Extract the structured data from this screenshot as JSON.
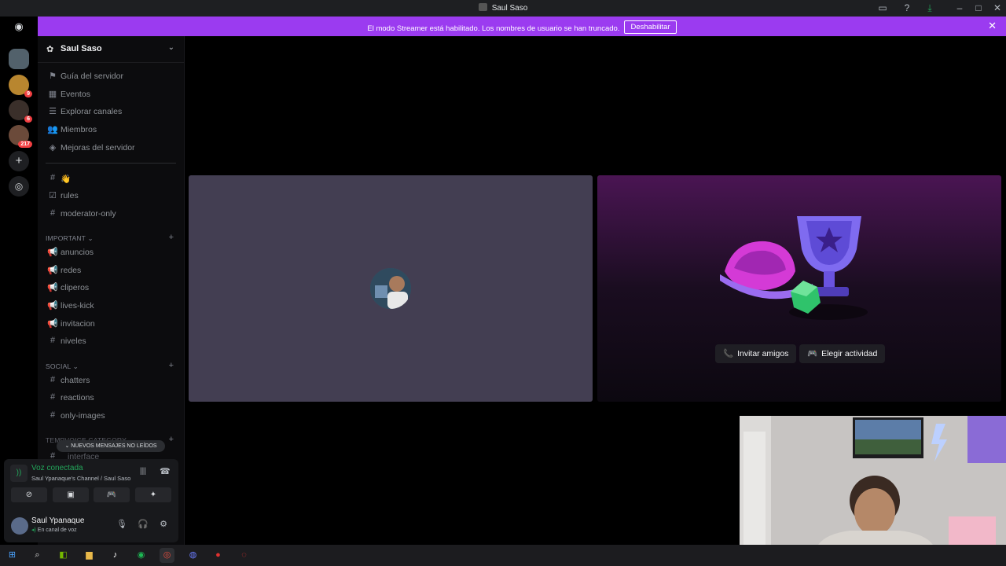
{
  "window": {
    "title": "Saul Saso"
  },
  "banner": {
    "message": "El modo Streamer está habilitado. Los nombres de usuario se han truncado.",
    "button_label": "Deshabilitar"
  },
  "guilds": [
    {
      "badge": ""
    },
    {
      "badge": "9"
    },
    {
      "badge": "6"
    },
    {
      "badge": "217"
    }
  ],
  "server": {
    "name": "Saul Saso"
  },
  "menu": [
    {
      "label": "Guía del servidor",
      "icon": "signpost-icon"
    },
    {
      "label": "Eventos",
      "icon": "calendar-icon"
    },
    {
      "label": "Explorar canales",
      "icon": "list-icon"
    },
    {
      "label": "Miembros",
      "icon": "members-icon"
    },
    {
      "label": "Mejoras del servidor",
      "icon": "boost-icon"
    }
  ],
  "channels_top": [
    {
      "label": "👋",
      "icon": "hash-icon"
    },
    {
      "label": "rules",
      "icon": "rules-icon"
    },
    {
      "label": "moderator-only",
      "icon": "hash-icon"
    }
  ],
  "categories": {
    "important": "IMPORTANT",
    "social": "SOCIAL",
    "tempvoice": "TEMPVOICE CATEGORY"
  },
  "important_channels": [
    {
      "label": "anuncios",
      "icon": "megaphone-icon"
    },
    {
      "label": "redes",
      "icon": "megaphone-icon"
    },
    {
      "label": "cliperos",
      "icon": "megaphone-icon"
    },
    {
      "label": "lives-kick",
      "icon": "megaphone-icon"
    },
    {
      "label": "invitacion",
      "icon": "megaphone-icon"
    },
    {
      "label": "niveles",
      "icon": "hash-icon"
    }
  ],
  "social_channels": [
    {
      "label": "chatters",
      "icon": "hash-icon"
    },
    {
      "label": "reactions",
      "icon": "hash-icon"
    },
    {
      "label": "only-images",
      "icon": "hash-icon"
    }
  ],
  "tempvoice_channel": "interface",
  "unread_pill": "NUEVOS MENSAJES NO LEÍDOS",
  "voice": {
    "title": "Voz conectada",
    "subtitle": "Saul Ypanaque's Channel / Saul Saso"
  },
  "user": {
    "name": "Saul Ypanaque",
    "status": "En canal de voz"
  },
  "activity": {
    "invite_label": "Invitar amigos",
    "choose_label": "Elegir actividad"
  },
  "colors": {
    "banner": "#9b3bf0",
    "connected": "#23a55a",
    "badge": "#f23f42"
  }
}
